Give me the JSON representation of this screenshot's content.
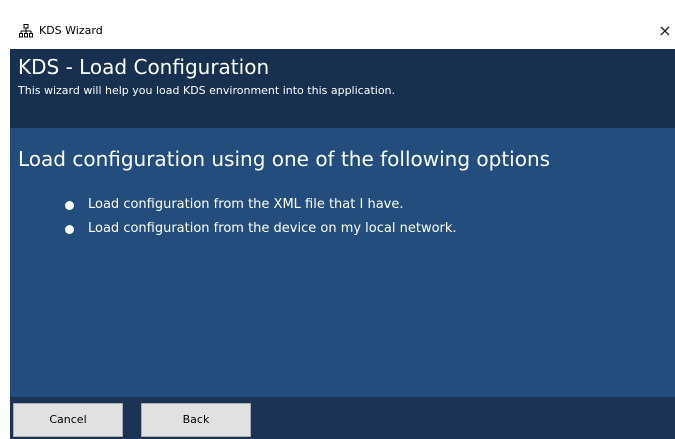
{
  "window": {
    "title": "KDS Wizard",
    "close_glyph": "×",
    "app_icon": "network-hierarchy-icon"
  },
  "header": {
    "title": "KDS - Load Configuration",
    "subtitle": "This wizard will help you load KDS environment into this application."
  },
  "content": {
    "section_title": "Load configuration using one of the following options",
    "options": [
      {
        "label": "Load configuration from the XML file that I have."
      },
      {
        "label": "Load configuration from the device on my local network."
      }
    ]
  },
  "footer": {
    "cancel_label": "Cancel",
    "back_label": "Back"
  },
  "colors": {
    "header_bg": "#17304f",
    "content_bg": "#234d7d",
    "footer_bg": "#1b3455",
    "button_bg": "#e1e1e1"
  }
}
